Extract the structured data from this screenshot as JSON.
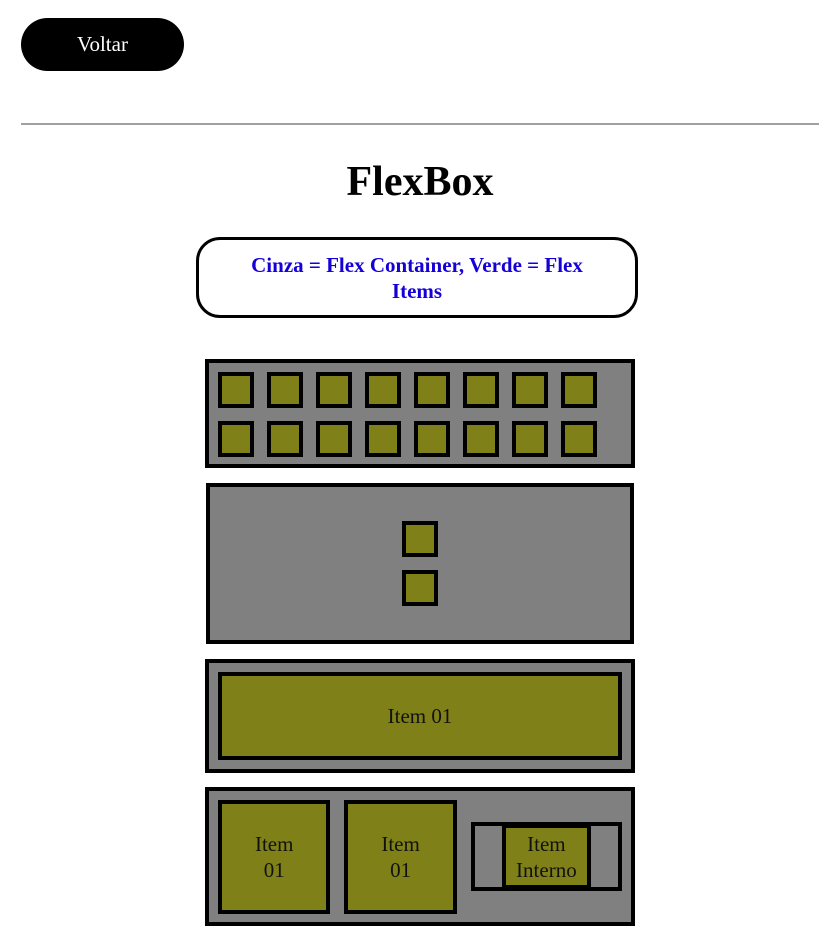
{
  "nav": {
    "back_label": "Voltar"
  },
  "page": {
    "title": "FlexBox"
  },
  "legend": {
    "text": "Cinza = Flex Container, Verde = Flex Items"
  },
  "colors": {
    "container": "#808080",
    "item": "#808018",
    "legend_text": "#1500d8",
    "button": "#000000"
  },
  "container1": {
    "item_count": 16
  },
  "container2": {
    "item_count": 2
  },
  "container3": {
    "item_label": "Item 01"
  },
  "container4": {
    "items": [
      {
        "label": "Item 01"
      },
      {
        "label": "Item 01"
      }
    ],
    "inner_item_label": "Item Interno"
  }
}
